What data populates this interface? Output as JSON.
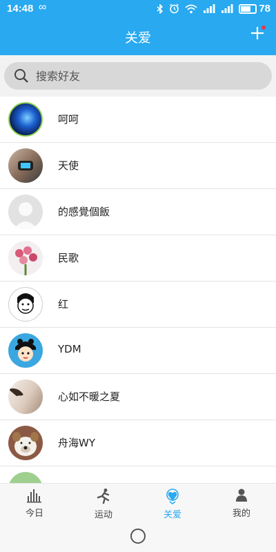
{
  "status_bar": {
    "time": "14:48",
    "loop_symbol": "∞",
    "battery_percent": "78",
    "battery_level": 0.78
  },
  "header": {
    "title": "关爱",
    "add_icon": "plus-icon"
  },
  "search": {
    "placeholder": "搜索好友"
  },
  "friends": [
    {
      "name": "呵呵",
      "avatar": "avatar-blue-glow"
    },
    {
      "name": "天使",
      "avatar": "avatar-fitness-band"
    },
    {
      "name": "的感覺個飯",
      "avatar": "avatar-default-person"
    },
    {
      "name": "民歌",
      "avatar": "avatar-flowers"
    },
    {
      "name": "红",
      "avatar": "avatar-cartoon-face"
    },
    {
      "name": "YDM",
      "avatar": "avatar-panda-hat"
    },
    {
      "name": "心如不暖之夏",
      "avatar": "avatar-girl-photo"
    },
    {
      "name": "舟海WY",
      "avatar": "avatar-bulldog"
    },
    {
      "name": "",
      "avatar": "avatar-green-partial"
    }
  ],
  "nav": {
    "active_tab": "关爱",
    "active_color": "#29a9f0",
    "tabs": [
      {
        "label": "今日",
        "icon": "bar-chart-icon"
      },
      {
        "label": "运动",
        "icon": "runner-icon"
      },
      {
        "label": "关爱",
        "icon": "care-heart-icon"
      },
      {
        "label": "我的",
        "icon": "person-icon"
      }
    ]
  },
  "colors": {
    "header_bg": "#29a9f0",
    "search_bg": "#d8d8d8",
    "divider": "#e3e3e3"
  }
}
